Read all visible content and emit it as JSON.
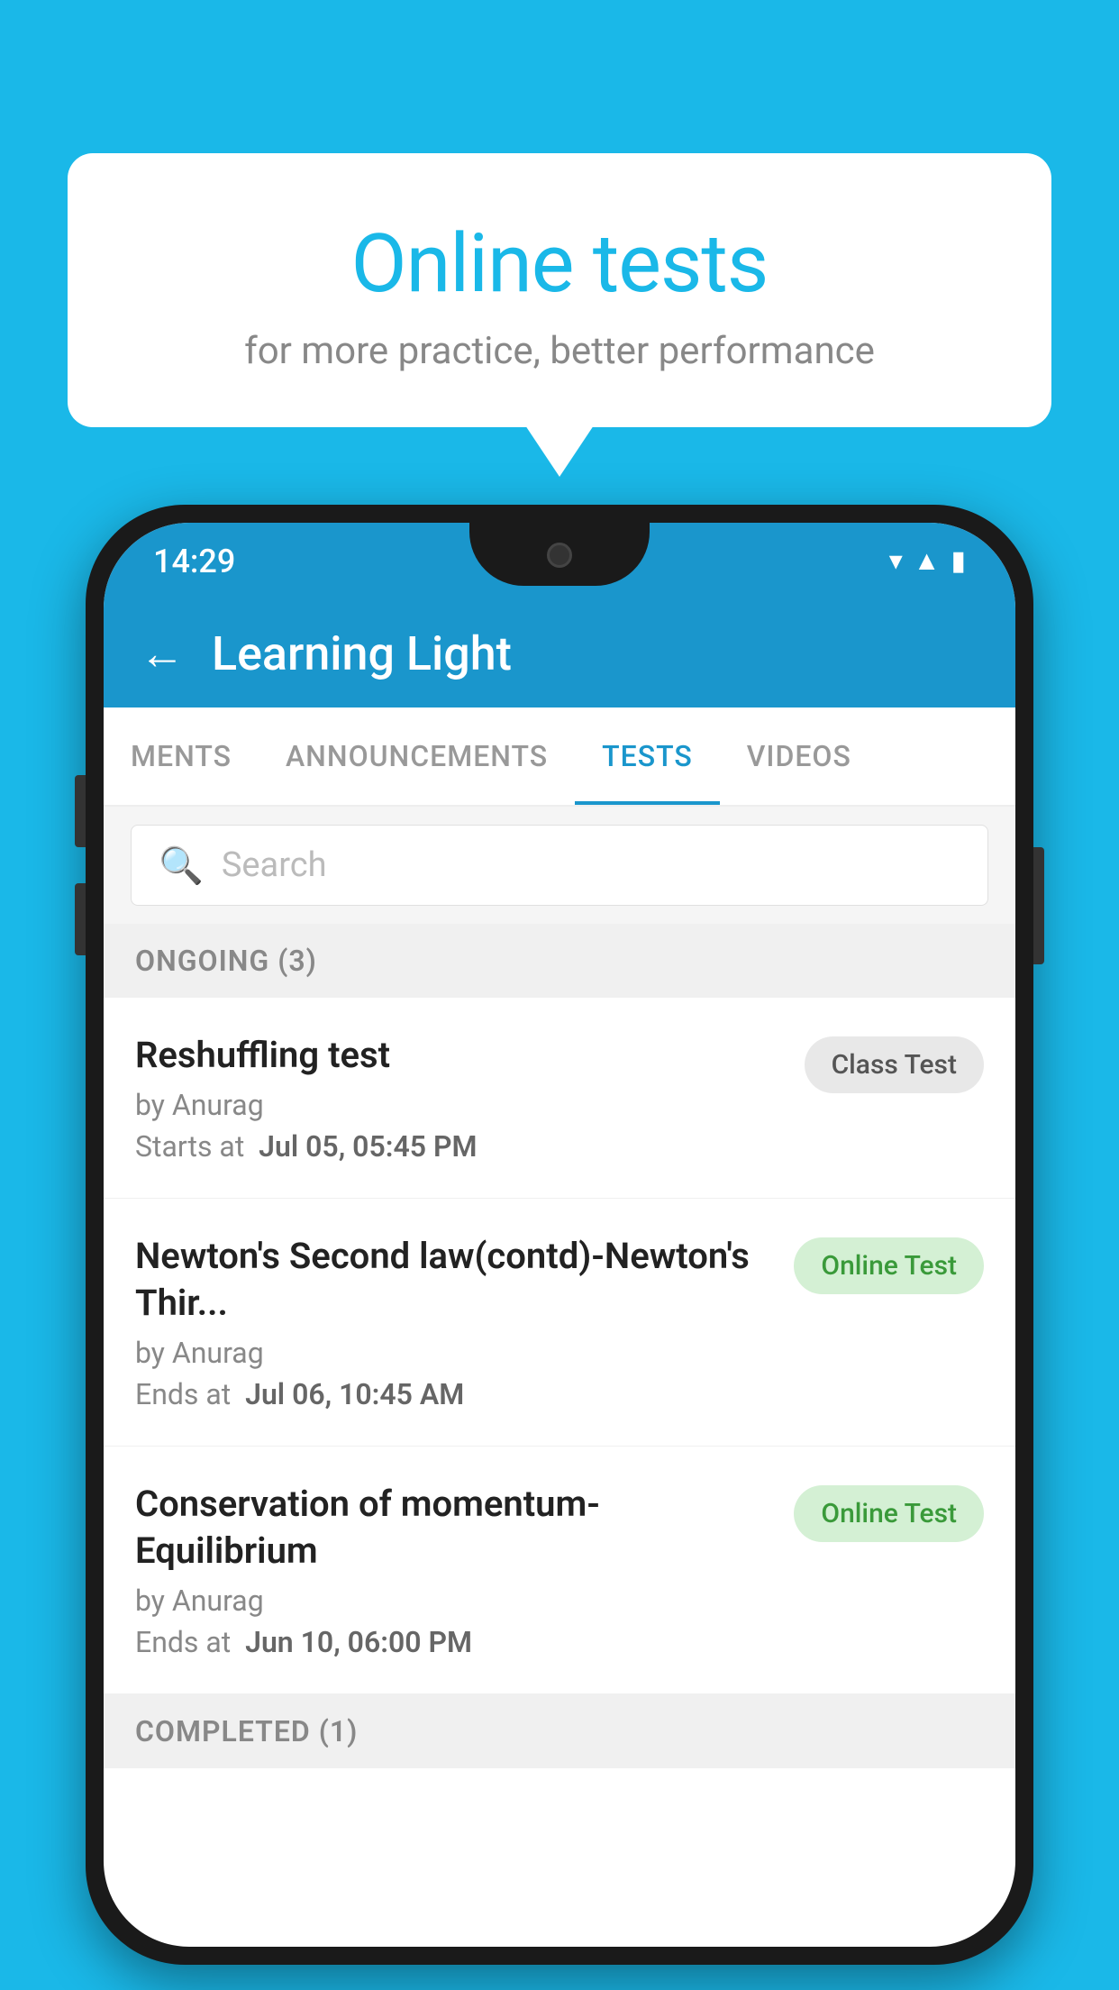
{
  "background": {
    "color": "#1ab8e8"
  },
  "speech_bubble": {
    "title": "Online tests",
    "subtitle": "for more practice, better performance"
  },
  "phone": {
    "status_bar": {
      "time": "14:29",
      "icons": [
        "wifi",
        "signal",
        "battery"
      ]
    },
    "app_bar": {
      "title": "Learning Light",
      "back_label": "←"
    },
    "tabs": [
      {
        "label": "MENTS",
        "active": false
      },
      {
        "label": "ANNOUNCEMENTS",
        "active": false
      },
      {
        "label": "TESTS",
        "active": true
      },
      {
        "label": "VIDEOS",
        "active": false
      }
    ],
    "search": {
      "placeholder": "Search"
    },
    "ongoing_section": {
      "label": "ONGOING (3)"
    },
    "tests": [
      {
        "title": "Reshuffling test",
        "author": "by Anurag",
        "date_label": "Starts at",
        "date_value": "Jul 05, 05:45 PM",
        "badge": "Class Test",
        "badge_type": "class"
      },
      {
        "title": "Newton's Second law(contd)-Newton's Thir...",
        "author": "by Anurag",
        "date_label": "Ends at",
        "date_value": "Jul 06, 10:45 AM",
        "badge": "Online Test",
        "badge_type": "online"
      },
      {
        "title": "Conservation of momentum-Equilibrium",
        "author": "by Anurag",
        "date_label": "Ends at",
        "date_value": "Jun 10, 06:00 PM",
        "badge": "Online Test",
        "badge_type": "online"
      }
    ],
    "completed_section": {
      "label": "COMPLETED (1)"
    }
  }
}
